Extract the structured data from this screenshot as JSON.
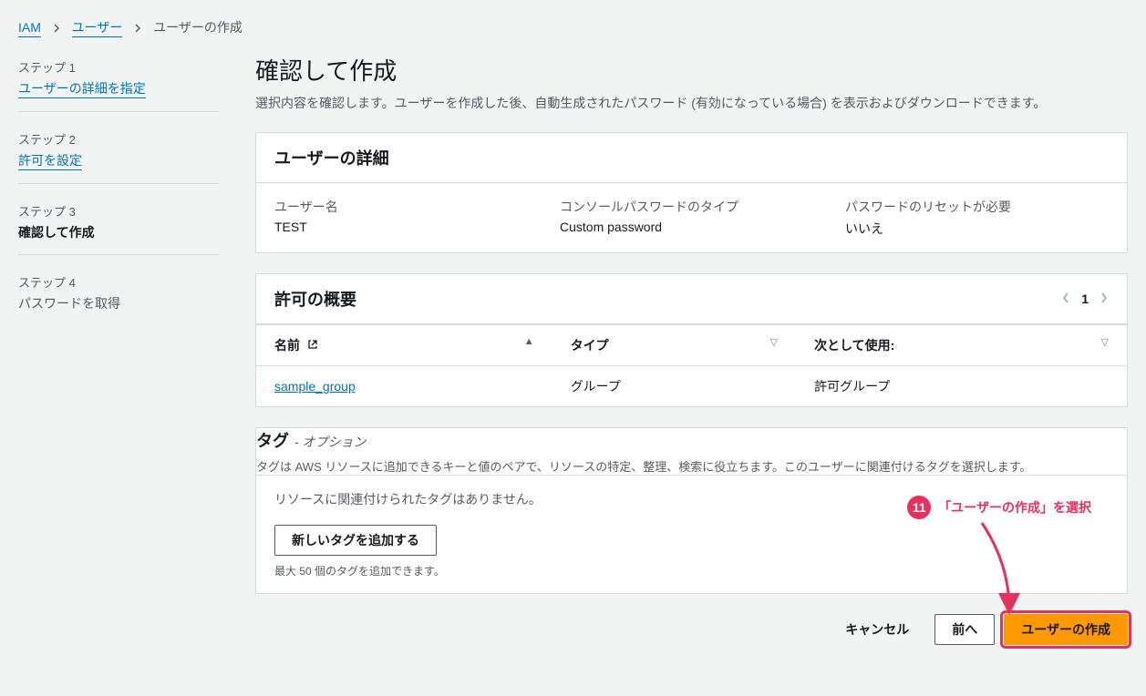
{
  "breadcrumb": {
    "root": "IAM",
    "users": "ユーザー",
    "current": "ユーザーの作成"
  },
  "steps": [
    {
      "label": "ステップ 1",
      "title": "ユーザーの詳細を指定",
      "state": "link"
    },
    {
      "label": "ステップ 2",
      "title": "許可を設定",
      "state": "link"
    },
    {
      "label": "ステップ 3",
      "title": "確認して作成",
      "state": "active"
    },
    {
      "label": "ステップ 4",
      "title": "パスワードを取得",
      "state": "disabled"
    }
  ],
  "page": {
    "title": "確認して作成",
    "description": "選択内容を確認します。ユーザーを作成した後、自動生成されたパスワード (有効になっている場合) を表示およびダウンロードできます。"
  },
  "user_details": {
    "heading": "ユーザーの詳細",
    "cols": [
      {
        "label": "ユーザー名",
        "value": "TEST"
      },
      {
        "label": "コンソールパスワードのタイプ",
        "value": "Custom password"
      },
      {
        "label": "パスワードのリセットが必要",
        "value": "いいえ"
      }
    ]
  },
  "permissions": {
    "heading": "許可の概要",
    "page_num": "1",
    "columns": {
      "name": "名前",
      "type": "タイプ",
      "used_as": "次として使用:"
    },
    "rows": [
      {
        "name": "sample_group",
        "type": "グループ",
        "used_as": "許可グループ"
      }
    ]
  },
  "tags": {
    "heading": "タグ",
    "optional": "- オプション",
    "description": "タグは AWS リソースに追加できるキーと値のペアで、リソースの特定、整理、検索に役立ちます。このユーザーに関連付けるタグを選択します。",
    "empty": "リソースに関連付けられたタグはありません。",
    "add_button": "新しいタグを追加する",
    "limit": "最大 50 個のタグを追加できます。"
  },
  "footer": {
    "cancel": "キャンセル",
    "prev": "前へ",
    "create": "ユーザーの作成"
  },
  "annotation": {
    "num": "11",
    "text": "「ユーザーの作成」を選択"
  }
}
